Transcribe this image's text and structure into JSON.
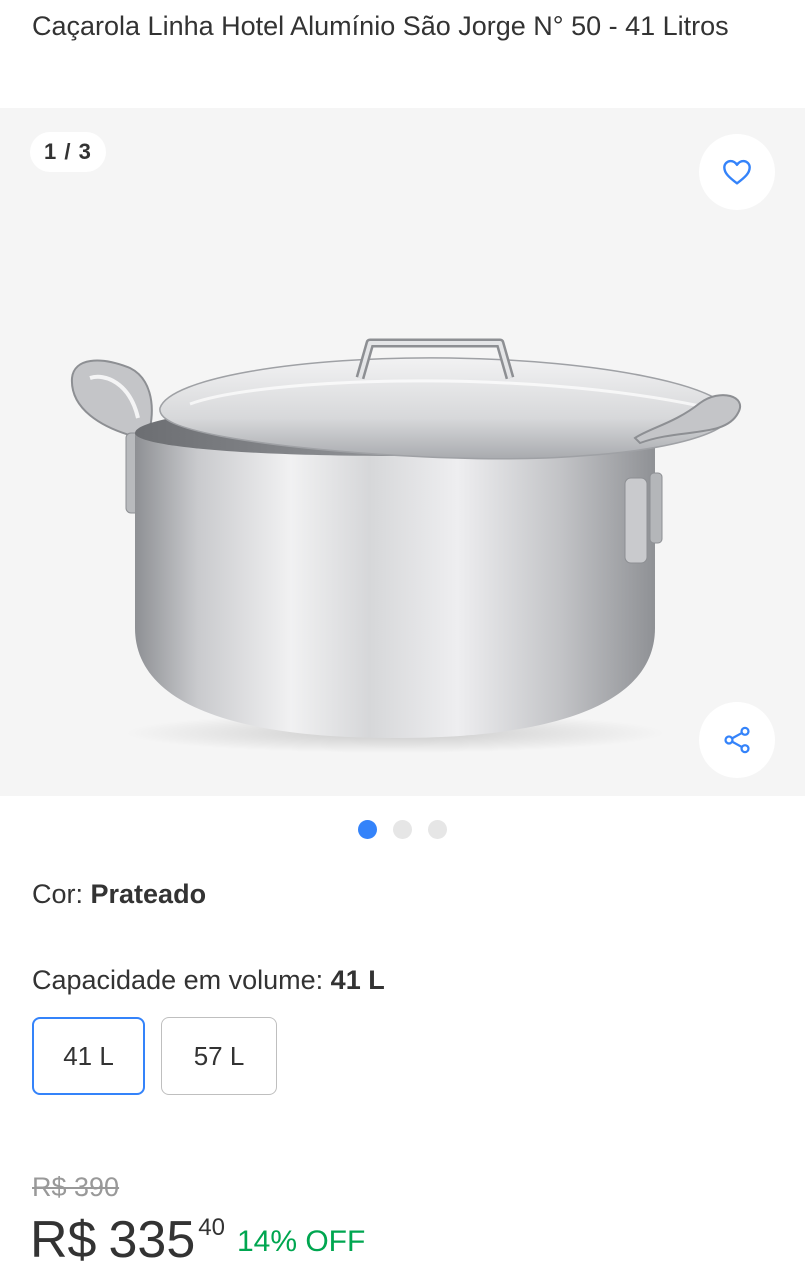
{
  "product": {
    "title": "Caçarola Linha Hotel Alumínio São Jorge N° 50 - 41 Litros"
  },
  "gallery": {
    "counter": "1 / 3",
    "favorite_icon": "heart-icon",
    "share_icon": "share-icon",
    "image_alt": "Caçarola de alumínio com tampa",
    "dots": {
      "count": 3,
      "active_index": 0
    }
  },
  "variations": {
    "color_label": "Cor: ",
    "color_value": "Prateado",
    "capacity_label": "Capacidade em volume: ",
    "capacity_value": "41 L",
    "capacity_options": [
      "41 L",
      "57 L"
    ],
    "selected_option": "41 L"
  },
  "price": {
    "original": "R$ 390",
    "currency": "R$",
    "integer": "335",
    "cents": "40",
    "discount": "14% OFF"
  },
  "colors": {
    "accent": "#3483fa",
    "discount": "#00a650",
    "text": "#333333",
    "muted": "#999999"
  }
}
